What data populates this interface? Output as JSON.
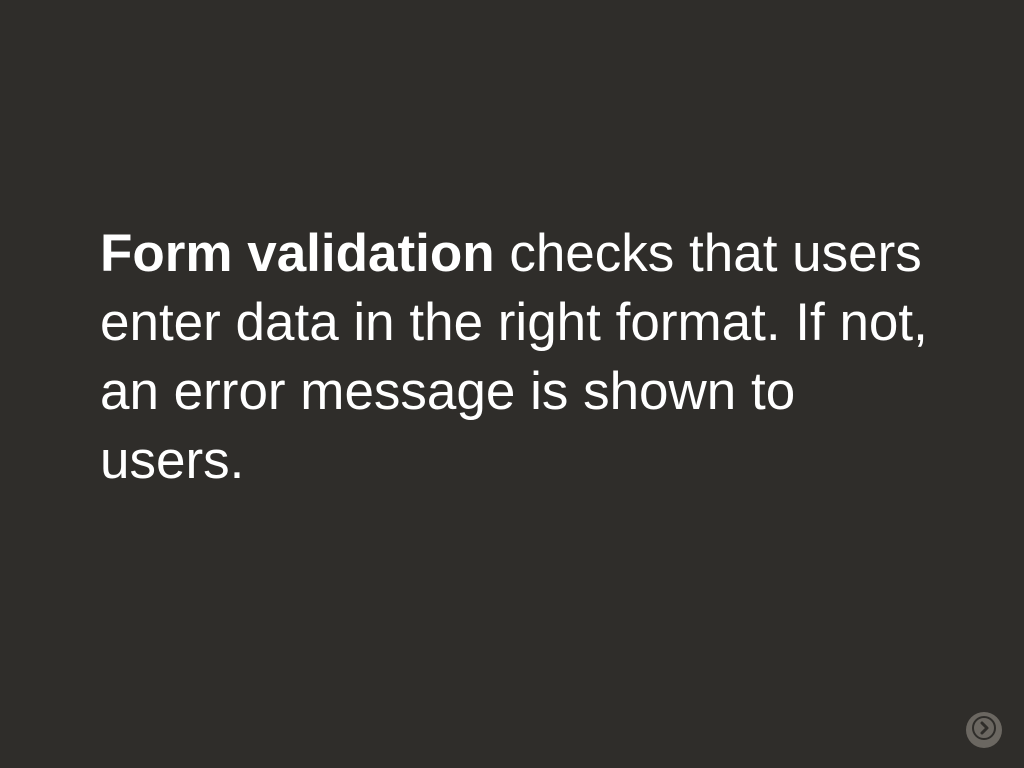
{
  "slide": {
    "text_bold": "Form validation",
    "text_rest": " checks that users enter data in the right format. If not, an error message is shown to users."
  },
  "controls": {
    "next_label": "Next"
  }
}
